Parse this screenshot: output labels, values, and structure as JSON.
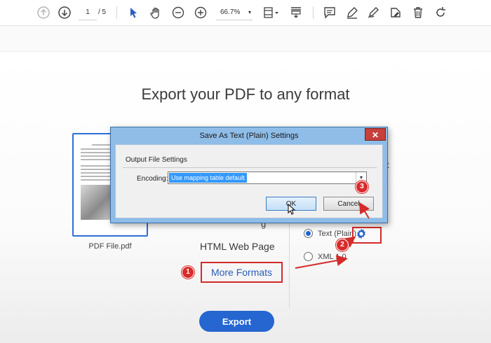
{
  "toolbar": {
    "page_current": "1",
    "page_total": "/ 5",
    "zoom": "66.7%",
    "zoom_caret": "▾"
  },
  "main": {
    "headline": "Export your PDF to any format",
    "file_name": "PDF File.pdf",
    "partial_format_label": "g",
    "partial_text_right": "t",
    "html_web_page": "HTML Web Page",
    "more_formats": "More Formats",
    "export_button": "Export"
  },
  "options": [
    {
      "label": "Text (Plain)",
      "selected": true
    },
    {
      "label": "XML 1.0",
      "selected": false
    }
  ],
  "dialog": {
    "title": "Save As Text (Plain) Settings",
    "close": "✕",
    "group_label": "Output File Settings",
    "encoding_label": "Encoding:",
    "encoding_value": "Use mapping table default",
    "encoding_arrow": "▾",
    "ok": "OK",
    "cancel": "Cancel"
  },
  "badges": {
    "one": "1",
    "two": "2",
    "three": "3"
  },
  "colors": {
    "accent": "#2566d1",
    "annotation": "#d42a2a",
    "dialog_frame": "#8fbde8"
  }
}
